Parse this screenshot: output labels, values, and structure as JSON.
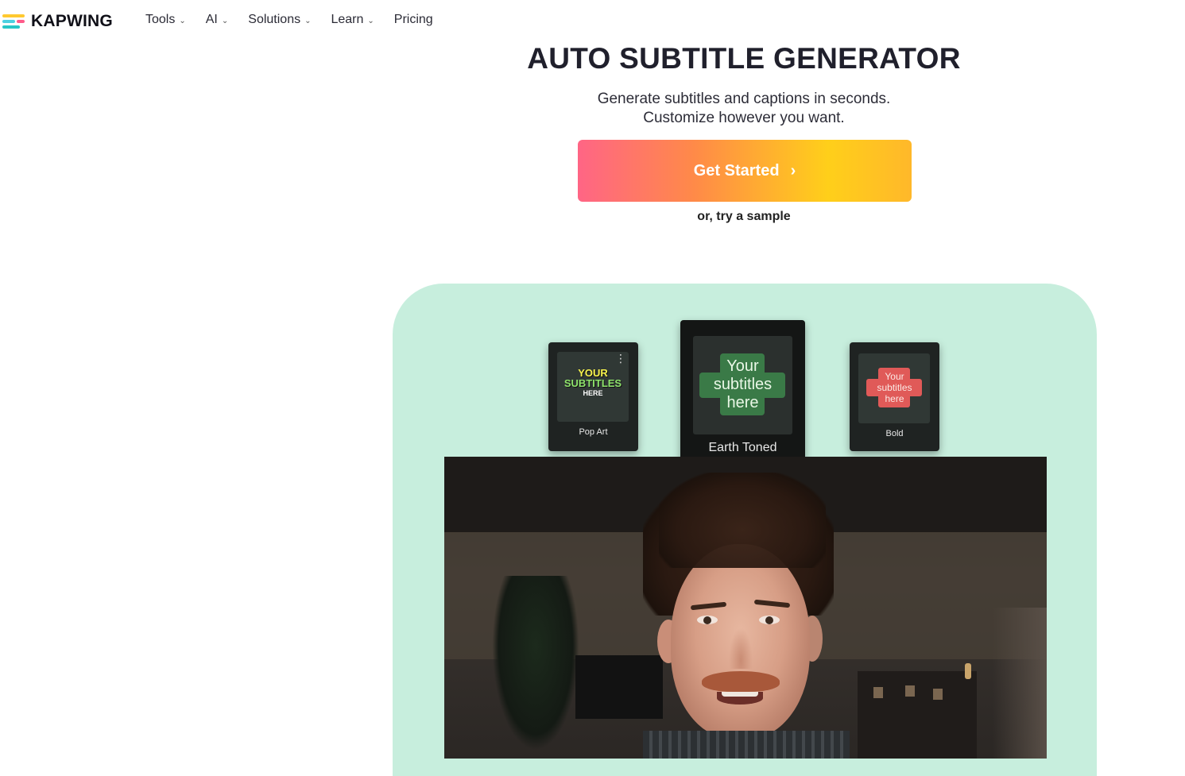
{
  "brand": {
    "name": "KAPWING"
  },
  "nav": {
    "items": [
      {
        "label": "Tools",
        "has_dropdown": true
      },
      {
        "label": "AI",
        "has_dropdown": true
      },
      {
        "label": "Solutions",
        "has_dropdown": true
      },
      {
        "label": "Learn",
        "has_dropdown": true
      },
      {
        "label": "Pricing",
        "has_dropdown": false
      }
    ],
    "dropdown_icon": "chevron-down-icon"
  },
  "hero": {
    "title": "AUTO SUBTITLE GENERATOR",
    "subtitle_line1": "Generate subtitles and captions in seconds.",
    "subtitle_line2": "Customize however you want.",
    "cta_label": "Get Started",
    "cta_icon": "chevron-right-icon",
    "sample_link": "or, try a sample"
  },
  "preview": {
    "panel_color": "#c7eedd",
    "styles": [
      {
        "label": "Pop Art",
        "text_lines": [
          "YOUR",
          "SUBTITLES",
          "HERE"
        ],
        "icon": "more-vertical-icon"
      },
      {
        "label": "Earth Toned",
        "text_lines": [
          "Your",
          "subtitles",
          "here"
        ],
        "selected": true
      },
      {
        "label": "Bold",
        "text_lines": [
          "Your",
          "subtitles",
          "here"
        ]
      }
    ]
  },
  "colors": {
    "cta_gradient": [
      "#ff6585",
      "#ff8a48",
      "#ffcf1a",
      "#ffb82a"
    ],
    "earth_toned_bubble": "#3a7a47",
    "bold_bubble": "#e05a58",
    "pop_art_yellow": "#f7f24c",
    "pop_art_green": "#8ee36b"
  }
}
